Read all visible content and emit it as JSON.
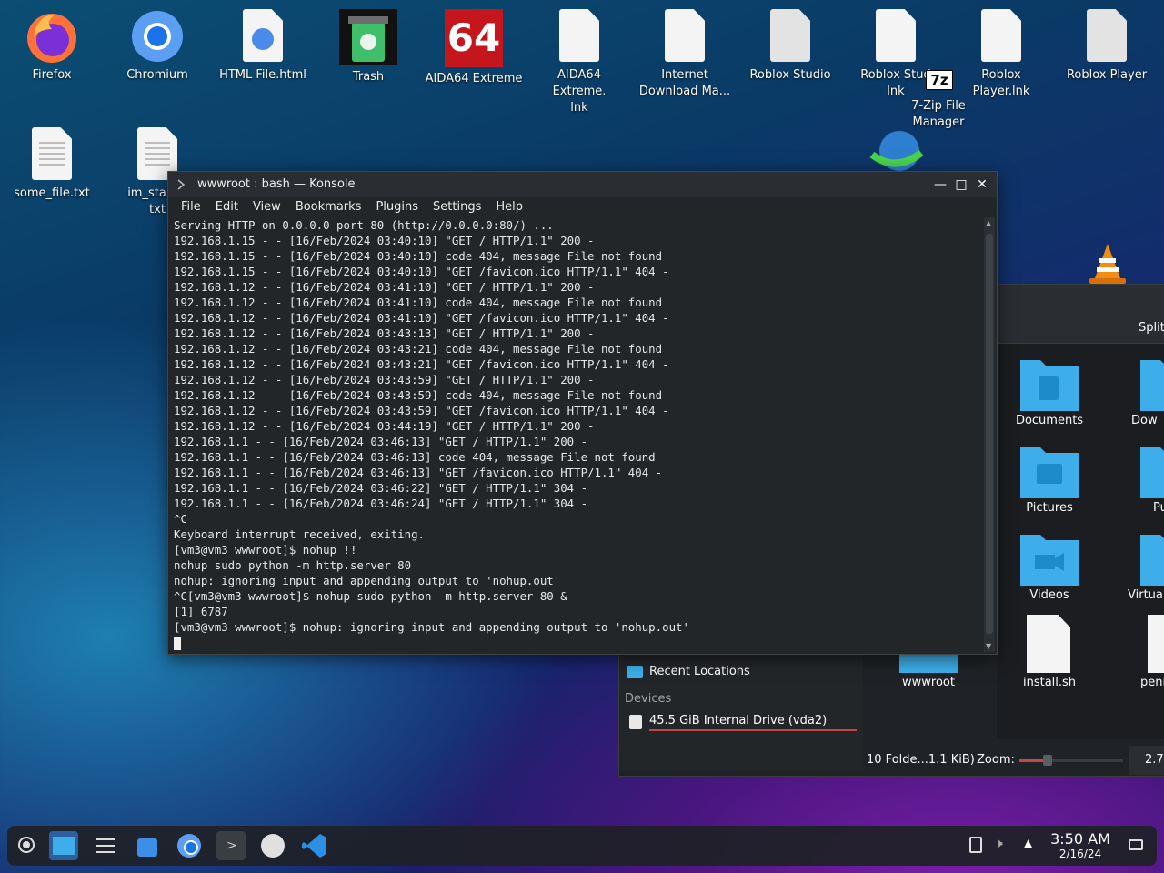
{
  "desktop": {
    "icons": [
      {
        "label": "Firefox"
      },
      {
        "label": "Chromium"
      },
      {
        "label": "HTML File.html"
      },
      {
        "label": "Trash"
      },
      {
        "label": "AIDA64 Extreme",
        "badge": "64"
      },
      {
        "label": "AIDA64 Extreme.\nlnk"
      },
      {
        "label": "Internet\nDownload Ma..."
      },
      {
        "label": "Roblox Studio"
      },
      {
        "label": "Roblox Stud\nlnk"
      },
      {
        "label": "Roblox Player.lnk",
        "badge": "7z"
      },
      {
        "label": "Roblox Player"
      },
      {
        "label": "7-Zip File\nManager"
      },
      {
        "label": "some_file.txt"
      },
      {
        "label": "im_stalkin\ntxt"
      }
    ]
  },
  "konsole": {
    "title": "wwwroot : bash — Konsole",
    "menu": [
      "File",
      "Edit",
      "View",
      "Bookmarks",
      "Plugins",
      "Settings",
      "Help"
    ],
    "lines": [
      "Serving HTTP on 0.0.0.0 port 80 (http://0.0.0.0:80/) ...",
      "192.168.1.15 - - [16/Feb/2024 03:40:10] \"GET / HTTP/1.1\" 200 -",
      "192.168.1.15 - - [16/Feb/2024 03:40:10] code 404, message File not found",
      "192.168.1.15 - - [16/Feb/2024 03:40:10] \"GET /favicon.ico HTTP/1.1\" 404 -",
      "192.168.1.12 - - [16/Feb/2024 03:41:10] \"GET / HTTP/1.1\" 200 -",
      "192.168.1.12 - - [16/Feb/2024 03:41:10] code 404, message File not found",
      "192.168.1.12 - - [16/Feb/2024 03:41:10] \"GET /favicon.ico HTTP/1.1\" 404 -",
      "192.168.1.12 - - [16/Feb/2024 03:43:13] \"GET / HTTP/1.1\" 200 -",
      "192.168.1.12 - - [16/Feb/2024 03:43:21] code 404, message File not found",
      "192.168.1.12 - - [16/Feb/2024 03:43:21] \"GET /favicon.ico HTTP/1.1\" 404 -",
      "192.168.1.12 - - [16/Feb/2024 03:43:59] \"GET / HTTP/1.1\" 200 -",
      "192.168.1.12 - - [16/Feb/2024 03:43:59] code 404, message File not found",
      "192.168.1.12 - - [16/Feb/2024 03:43:59] \"GET /favicon.ico HTTP/1.1\" 404 -",
      "192.168.1.12 - - [16/Feb/2024 03:44:19] \"GET / HTTP/1.1\" 200 -",
      "192.168.1.1 - - [16/Feb/2024 03:46:13] \"GET / HTTP/1.1\" 200 -",
      "192.168.1.1 - - [16/Feb/2024 03:46:13] code 404, message File not found",
      "192.168.1.1 - - [16/Feb/2024 03:46:13] \"GET /favicon.ico HTTP/1.1\" 404 -",
      "192.168.1.1 - - [16/Feb/2024 03:46:22] \"GET / HTTP/1.1\" 304 -",
      "192.168.1.1 - - [16/Feb/2024 03:46:24] \"GET / HTTP/1.1\" 304 -",
      "^C",
      "Keyboard interrupt received, exiting.",
      "[vm3@vm3 wwwroot]$ nohup !!",
      "nohup sudo python -m http.server 80",
      "nohup: ignoring input and appending output to 'nohup.out'",
      "^C[vm3@vm3 wwwroot]$ nohup sudo python -m http.server 80 &",
      "[1] 6787",
      "[vm3@vm3 wwwroot]$ nohup: ignoring input and appending output to 'nohup.out'"
    ]
  },
  "dolphin": {
    "split_label": "Split",
    "items": [
      {
        "label": "Documents"
      },
      {
        "label": "Dow"
      },
      {
        "label": "Pictures"
      },
      {
        "label": "Pu"
      },
      {
        "label": "Videos"
      },
      {
        "label": "Virtua"
      },
      {
        "label": "wwwroot"
      },
      {
        "label": "install.sh"
      },
      {
        "label": "peni"
      }
    ],
    "sidebar": {
      "recent": "Recent Locations",
      "devices_header": "Devices",
      "drive": "45.5 GiB Internal Drive (vda2)"
    },
    "status": {
      "summary": "10 Folde...1.1 KiB)",
      "zoom_label": "Zoom:",
      "free": "2.7"
    }
  },
  "taskbar": {
    "time": "3:50 AM",
    "date": "2/16/24"
  },
  "colors": {
    "accent": "#3daee9",
    "terminal_bg": "#232629",
    "folder_blue": "#3daee9"
  }
}
